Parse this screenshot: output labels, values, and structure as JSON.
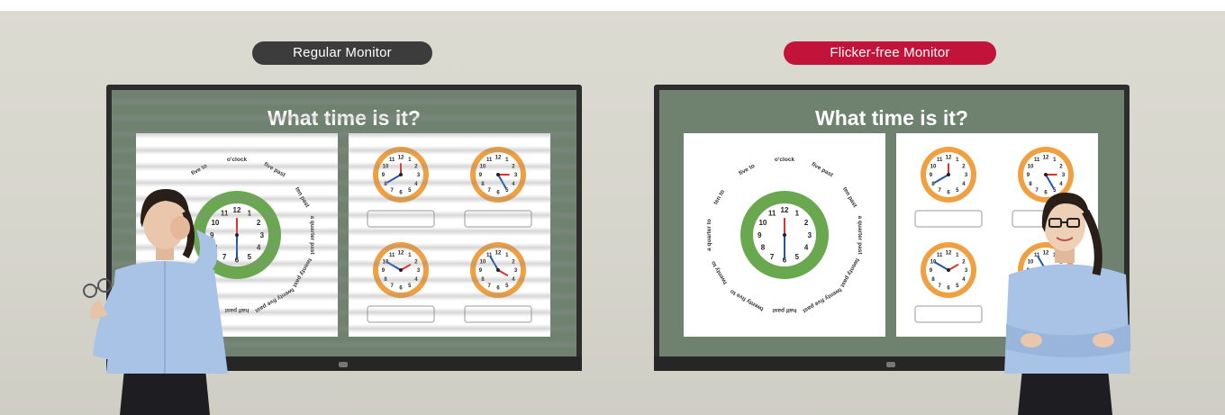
{
  "labels": {
    "regular": "Regular Monitor",
    "flicker_free": "Flicker-free Monitor"
  },
  "screen": {
    "title": "What time is it?",
    "big_clock_phrases": [
      "o'clock",
      "five past",
      "ten past",
      "a quarter past",
      "twenty past",
      "twenty five past",
      "half past",
      "twenty five to",
      "twenty to",
      "a quarter to",
      "ten to",
      "five to"
    ],
    "clock_numbers": [
      "12",
      "1",
      "2",
      "3",
      "4",
      "5",
      "6",
      "7",
      "8",
      "9",
      "10",
      "11"
    ]
  },
  "colors": {
    "regular_pill": "#3c3c3c",
    "flicker_pill": "#c2133a",
    "screen_green": "#6f8270",
    "clock_green": "#6aa84f",
    "clock_orange": "#f0a040"
  },
  "icons": [
    "glasses-icon",
    "lg-logo-icon"
  ]
}
